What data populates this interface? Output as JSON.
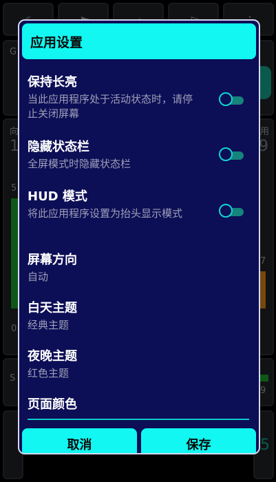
{
  "dialog": {
    "title": "应用设置",
    "settings": [
      {
        "title": "保持长亮",
        "desc": "当此应用程序处于活动状态时，请停止关闭屏幕",
        "toggle": "on"
      },
      {
        "title": "隐藏状态栏",
        "desc": "全屏模式时隐藏状态栏",
        "toggle": "on"
      },
      {
        "title": "HUD 模式",
        "desc": "将此应用程序设置为抬头显示模式",
        "toggle": "on"
      },
      {
        "title": "屏幕方向",
        "desc": "自动"
      },
      {
        "title": "白天主题",
        "desc": "经典主题"
      },
      {
        "title": "夜晚主题",
        "desc": "红色主题"
      },
      {
        "title": "页面颜色",
        "desc": ""
      }
    ],
    "cancel_label": "取消",
    "save_label": "保存"
  },
  "background": {
    "left_labels": [
      "G",
      "向",
      "1",
      "5",
      "0",
      "S"
    ],
    "right_labels": [
      "用",
      "9",
      "7",
      "9",
      "5"
    ]
  },
  "colors": {
    "dialog_bg": "#0c0e56",
    "accent": "#12f7f1",
    "toggle_track": "#16837d"
  }
}
